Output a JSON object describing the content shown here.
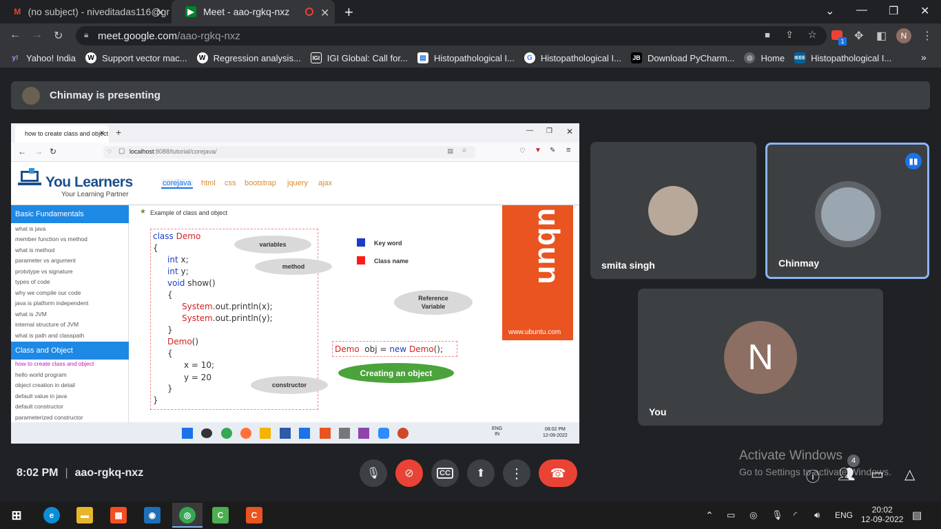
{
  "browser": {
    "tabs": [
      {
        "title": "(no subject) - niveditadas116@gr",
        "icon": "gmail-icon",
        "active": false
      },
      {
        "title": "Meet - aao-rgkq-nxz",
        "icon": "meet-icon",
        "active": true
      }
    ],
    "url_host": "meet.google.com",
    "url_path": "/aao-rgkq-nxz",
    "profile_initial": "N",
    "extension_badge": "1",
    "bookmarks": [
      {
        "label": "Yahoo! India",
        "icon": "yahoo-icon",
        "color": "#6001d2"
      },
      {
        "label": "Support vector mac...",
        "icon": "wikipedia-icon",
        "color": "#ffffff"
      },
      {
        "label": "Regression analysis...",
        "icon": "wikipedia-icon",
        "color": "#ffffff"
      },
      {
        "label": "IGI Global: Call for...",
        "icon": "igi-icon",
        "color": "#ffffff"
      },
      {
        "label": "Histopathological I...",
        "icon": "doc-icon",
        "color": "#ffffff"
      },
      {
        "label": "Histopathological I...",
        "icon": "google-icon",
        "color": "#ffffff"
      },
      {
        "label": "Download PyCharm...",
        "icon": "jetbrains-icon",
        "color": "#000000"
      },
      {
        "label": "Home",
        "icon": "globe-icon",
        "color": "#9aa0a6"
      },
      {
        "label": "Histopathological I...",
        "icon": "ieee-icon",
        "color": "#00629b"
      }
    ]
  },
  "meet": {
    "presenting_text": "Chinmay is presenting",
    "time": "8:02 PM",
    "meeting_code": "aao-rgkq-nxz",
    "participants_count": "4",
    "tiles": [
      {
        "name": "smita singh"
      },
      {
        "name": "Chinmay",
        "speaking": true
      },
      {
        "name": "You",
        "initial": "N",
        "avatar_color": "#8d6e63"
      }
    ],
    "activate": {
      "line1": "Activate Windows",
      "line2": "Go to Settings to activate Windows."
    },
    "accent_red": "#ea4335",
    "accent_blue": "#8ab4f8"
  },
  "shared_screen": {
    "tab_title": "how to create class and object",
    "url_host": "localhost",
    "url_path": ":8088/tutorial/corejava/",
    "logo_title": "You Learners",
    "logo_tagline": "Your Learning Partner",
    "nav": [
      "corejava",
      "html",
      "css",
      "bootstrap",
      "jquery",
      "ajax"
    ],
    "sidebar": {
      "section1": "Basic Fundamentals",
      "items1": [
        "what is java",
        "member function vs method",
        "what is method",
        "parameter vs argument",
        "prototype vs signature",
        "types of code",
        "why we compile our code",
        "java is platform independent",
        "what is JVM",
        "internal structure of JVM",
        "what is path and classpath"
      ],
      "section2": "Class and Object",
      "items2": [
        "how to create class and object",
        "hello world program",
        "object creation in detail",
        "default value in java",
        "default constructor",
        "parameterized constructor"
      ]
    },
    "heading": "Example of class and object",
    "code": {
      "class_kw": "class",
      "class_name": "Demo",
      "open1": "{",
      "int1": "int",
      "x": "x;",
      "int2": "int",
      "y": "y;",
      "void_kw": "void",
      "show": "show()",
      "open2": "{",
      "sys1": "System",
      "sys1_rest": ".out.println(x);",
      "sys2": "System",
      "sys2_rest": ".out.println(y);",
      "close2": "}",
      "ctor": "Demo",
      "ctor_rest": "()",
      "open3": "{",
      "xa": "x = 10;",
      "ya": "y = 20",
      "close3": "}",
      "close1": "}"
    },
    "bubbles": {
      "variables": "variables",
      "method": "method",
      "constructor": "constructor",
      "refvar1": "Reference",
      "refvar2": "Variable"
    },
    "legend": {
      "keyword": "Key word",
      "classname": "Class name",
      "keyword_color": "#1a3cc8",
      "classname_color": "#ff1a1a"
    },
    "obj": {
      "demo": "Demo",
      "obj": "obj",
      "eq": "=",
      "new": "new",
      "demo2": "Demo",
      "rest": "();"
    },
    "creating": "Creating an object",
    "ubuntu_logo": "ubun",
    "ubuntu_url": "www.ubuntu.com",
    "taskbar": {
      "lang1": "ENG",
      "lang2": "IN",
      "time": "08:02 PM",
      "date": "12-09-2022"
    }
  },
  "windows_taskbar": {
    "lang": "ENG",
    "time": "20:02",
    "date": "12-09-2022"
  }
}
